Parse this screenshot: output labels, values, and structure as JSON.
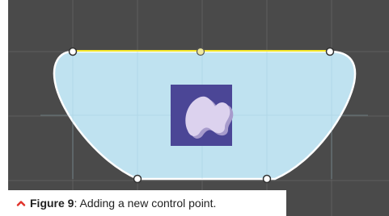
{
  "scene": {
    "background_color": "#4a4a4a",
    "grid_color": "#5e5e5e",
    "shape_fill": "#bfe2f0",
    "shape_outline": "#ffffff",
    "selected_edge_color": "#f2e52a",
    "sprite_background": "#4b4696",
    "sprite_foreground": "#dcd2ee",
    "sprite_shadow": "#a79bcc"
  },
  "caption": {
    "figure_label": "Figure 9",
    "text": ": Adding a new control point.",
    "accent_color": "#e0322a",
    "caret_icon": "chevron-up-icon"
  }
}
